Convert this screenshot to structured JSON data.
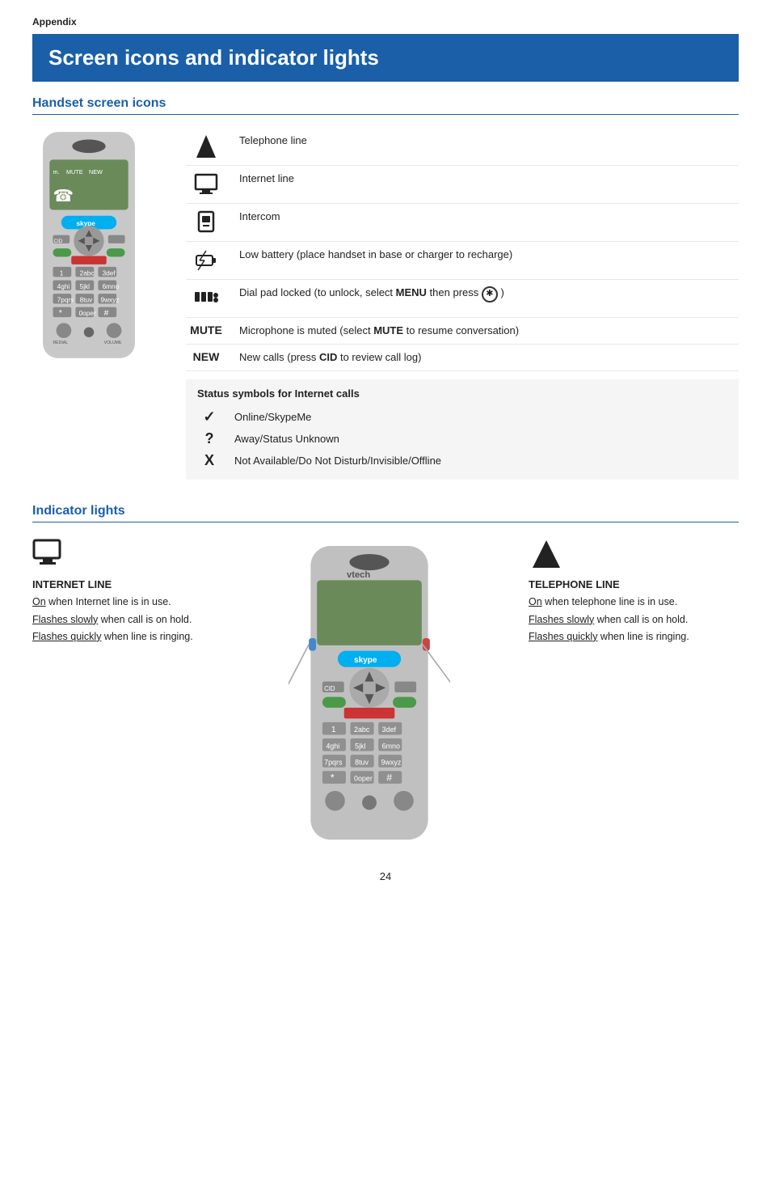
{
  "appendix": {
    "label": "Appendix"
  },
  "page_title": "Screen icons and indicator lights",
  "handset_section": {
    "title": "Handset screen icons",
    "icons": [
      {
        "icon_type": "telephone",
        "description": "Telephone line"
      },
      {
        "icon_type": "monitor",
        "description": "Internet line"
      },
      {
        "icon_type": "intercom",
        "description": "Intercom"
      },
      {
        "icon_type": "battery",
        "description": "Low battery (place handset in base or charger to recharge)"
      },
      {
        "icon_type": "dialpad",
        "description_prefix": "Dial pad locked (to unlock, select ",
        "description_bold": "MENU",
        "description_suffix": " then press"
      },
      {
        "icon_type": "mute_label",
        "label": "MUTE",
        "description_prefix": "Microphone is muted (select ",
        "description_bold": "MUTE",
        "description_suffix": " to resume conversation)"
      },
      {
        "icon_type": "new_label",
        "label": "NEW",
        "description_prefix": "New calls (press ",
        "description_bold": "CID",
        "description_suffix": " to review call log)"
      }
    ],
    "status_group": {
      "title": "Status symbols for Internet calls",
      "items": [
        {
          "symbol": "✓",
          "description": "Online/SkypeMe"
        },
        {
          "symbol": "?",
          "description": "Away/Status Unknown"
        },
        {
          "symbol": "X",
          "description": "Not Available/Do Not Disturb/Invisible/Offline"
        }
      ]
    }
  },
  "indicator_section": {
    "title": "Indicator lights",
    "internet_line": {
      "label": "INTERNET LINE",
      "lines": [
        {
          "prefix": "On",
          "rest": " when Internet line is in use."
        },
        {
          "prefix": "Flashes slowly",
          "rest": " when call is on hold."
        },
        {
          "prefix": "Flashes quickly",
          "rest": " when line is ringing."
        }
      ]
    },
    "telephone_line": {
      "label": "TELEPHONE LINE",
      "lines": [
        {
          "prefix": "On",
          "rest": " when telephone line is in use."
        },
        {
          "prefix": "Flashes slowly",
          "rest": " when call is on hold."
        },
        {
          "prefix": "Flashes quickly",
          "rest": " when line is ringing."
        }
      ]
    }
  },
  "page_number": "24"
}
